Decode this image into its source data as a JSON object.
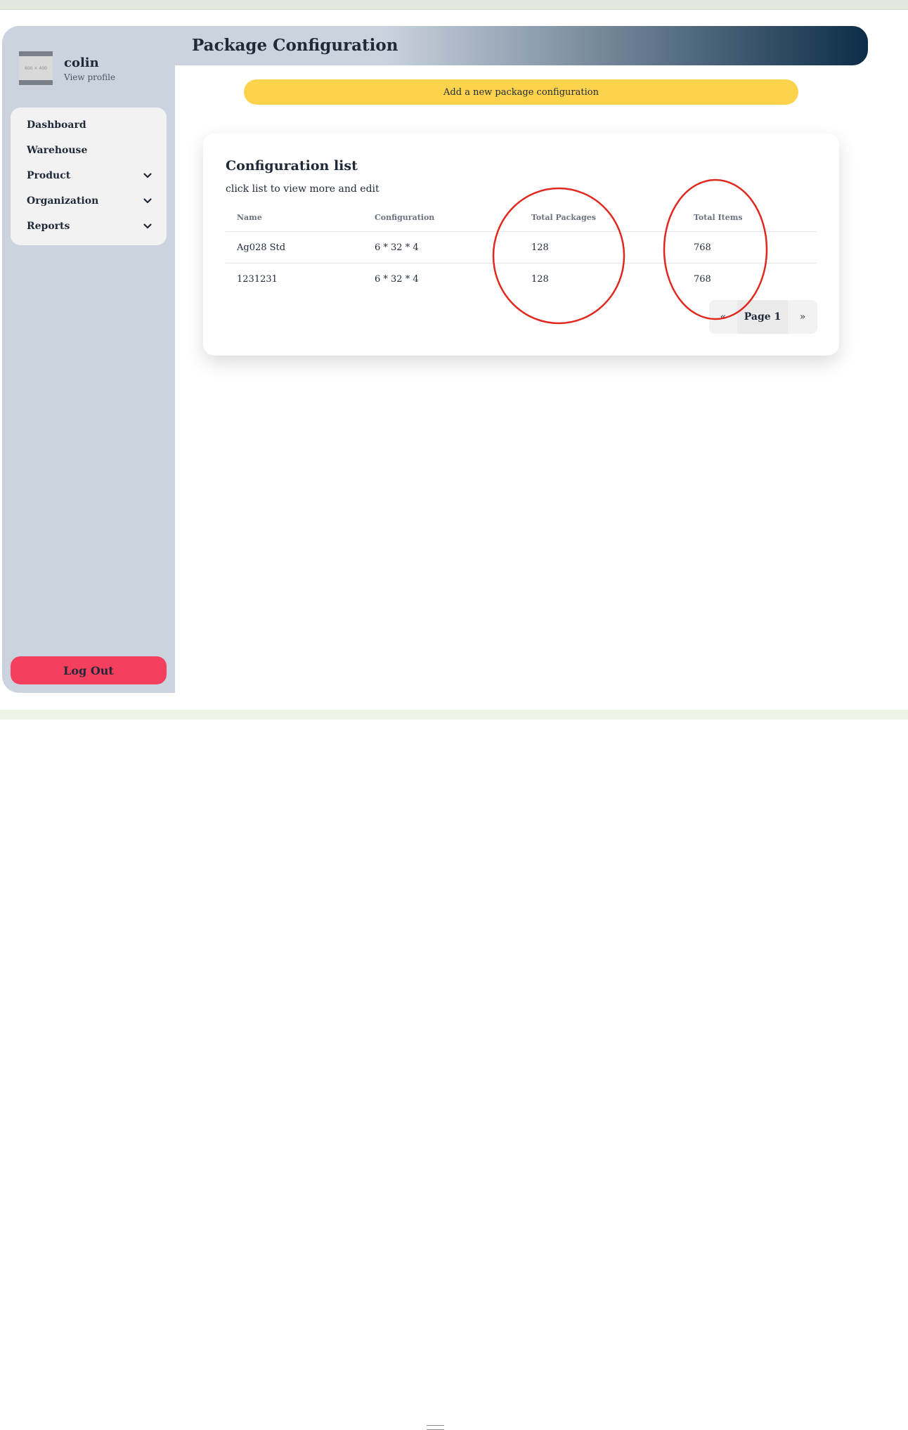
{
  "page": {
    "title": "Package Configuration"
  },
  "user": {
    "name": "colin",
    "view_profile": "View profile",
    "avatar_text": "600 × 400"
  },
  "sidebar": {
    "items": [
      {
        "label": "Dashboard",
        "has_submenu": false
      },
      {
        "label": "Warehouse",
        "has_submenu": false
      },
      {
        "label": "Product",
        "has_submenu": true
      },
      {
        "label": "Organization",
        "has_submenu": true
      },
      {
        "label": "Reports",
        "has_submenu": true
      }
    ],
    "logout_label": "Log Out"
  },
  "actions": {
    "add_label": "Add a new package configuration"
  },
  "card": {
    "title": "Configuration list",
    "subtitle": "click list to view more and edit"
  },
  "table": {
    "headers": [
      "Name",
      "Configuration",
      "Total Packages",
      "Total Items"
    ],
    "rows": [
      [
        "Ag028 Std",
        "6 * 32 * 4",
        "128",
        "768"
      ],
      [
        "1231231",
        "6 * 32 * 4",
        "128",
        "768"
      ]
    ]
  },
  "pagination": {
    "prev": "«",
    "label": "Page 1",
    "next": "»"
  },
  "colors": {
    "sidebar_bg": "#cbd3df",
    "header_gradient_end": "#0c2d48",
    "add_button": "#fdd34d",
    "logout_button": "#f43f5e",
    "annotation": "#e0281e"
  },
  "icons": {
    "menu_expand": "chevron-down-icon"
  }
}
